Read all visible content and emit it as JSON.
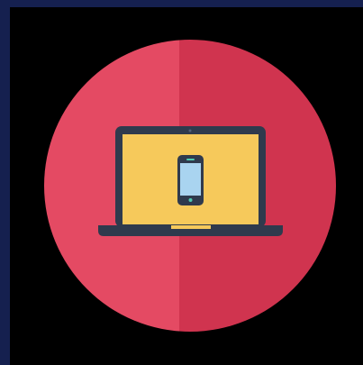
{
  "colors": {
    "border": "#15204f",
    "background": "#000000",
    "circle_left": "#e44a63",
    "circle_right": "#d0344f",
    "laptop_body": "#2f3a4d",
    "laptop_screen": "#f6c95b",
    "phone_body": "#2f3a4d",
    "phone_screen": "#a9d4f0",
    "phone_button": "#4ec9b0",
    "trackpad_slot": "#f6c95b"
  },
  "icons": {
    "main": "laptop-with-smartphone-icon"
  }
}
